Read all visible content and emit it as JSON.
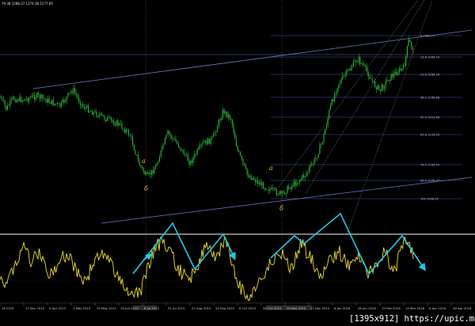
{
  "header": {
    "ohlc_label": "79.38 1286.37 1274.38 1277.60"
  },
  "colors": {
    "background": "#000000",
    "price_up": "#2ecc3a",
    "price_down": "#38c047",
    "channel": "#6b7cc8",
    "fib": "#4a5ab0",
    "oscillator": "#f0e030",
    "arrows": "#22c8e8",
    "separator": "#c8c8c8",
    "wave_labels": "#e6c040"
  },
  "fib_levels": [
    {
      "label": "0 1303.75"
    },
    {
      "label": "13.8 1283.73"
    },
    {
      "label": "23.6 1266.18"
    },
    {
      "label": "38.2 1238.48"
    },
    {
      "label": "50.0 1215.48"
    },
    {
      "label": "61.8 1193.95"
    },
    {
      "label": "76.4 1163.59"
    },
    {
      "label": "86.6 1076.32"
    },
    {
      "label": "100 1046.32"
    }
  ],
  "wave_labels": [
    {
      "text": "a"
    },
    {
      "text": "б"
    },
    {
      "text": "a"
    },
    {
      "text": "б"
    }
  ],
  "date_labels": [
    "16 2015",
    "17 Mar 2015",
    "9 Apr 2015",
    "1 May 2015",
    "25 May 2015",
    "16 Jun 2015",
    "8 Jul 2015",
    "31 Jul 2015",
    "21 Aug 2015",
    "14 Sep 2015",
    "6 Oct 2015",
    "28 Oct 2015",
    "19 Nov 2015",
    "11 Dec 2015",
    "6 Jan 2016",
    "28 Jan 2016",
    "19 Feb 2016",
    "14 Mar 2016",
    "6 Apr 2016",
    "28 Apr 2016"
  ],
  "watermark": "[1395x912] https://upic.me/"
}
